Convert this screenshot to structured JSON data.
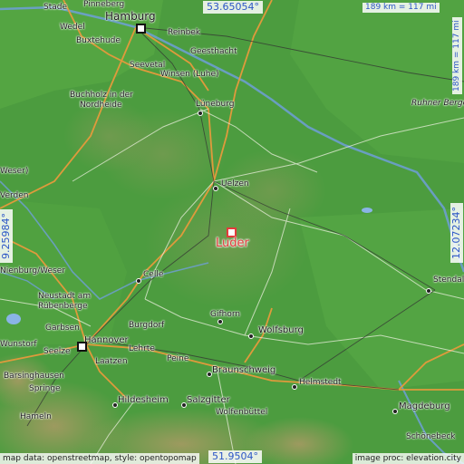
{
  "target": {
    "label": "Luder",
    "color": "#e23b3b"
  },
  "coordinates": {
    "top_lat": "53.65054°",
    "bottom_lat": "51.9504°",
    "left_lon": "9.25984°",
    "right_lon": "12.07234°"
  },
  "scale": {
    "horizontal": "189 km = 117 mi",
    "vertical": "189 km = 117 mi"
  },
  "credits": {
    "left": "map data: openstreetmap, style: opentopomap",
    "right": "image proc: elevation.city"
  },
  "places": [
    {
      "name": "Stade",
      "size": "small"
    },
    {
      "name": "Pinneberg",
      "size": "small"
    },
    {
      "name": "Hamburg",
      "size": "big"
    },
    {
      "name": "Wedel",
      "size": "small"
    },
    {
      "name": "Reinbek",
      "size": "small"
    },
    {
      "name": "Buxtehude",
      "size": "small"
    },
    {
      "name": "Geesthacht",
      "size": "small"
    },
    {
      "name": "Seevetal",
      "size": "small"
    },
    {
      "name": "Winsen (Luhe)",
      "size": "small"
    },
    {
      "name": "Buchholz in der",
      "size": "small"
    },
    {
      "name": "Nordheide",
      "size": "small"
    },
    {
      "name": "Lüneburg",
      "size": "small"
    },
    {
      "name": "Ruhner Berge",
      "size": "small"
    },
    {
      "name": "Weser)",
      "size": "small"
    },
    {
      "name": "Uelzen",
      "size": "small"
    },
    {
      "name": "Verden",
      "size": "small"
    },
    {
      "name": "Nienburg/Weser",
      "size": "small"
    },
    {
      "name": "Celle",
      "size": "small"
    },
    {
      "name": "Stendal",
      "size": "small"
    },
    {
      "name": "Neustadt am",
      "size": "small"
    },
    {
      "name": "Rübenberge",
      "size": "small"
    },
    {
      "name": "Garbsen",
      "size": "small"
    },
    {
      "name": "Burgdorf",
      "size": "small"
    },
    {
      "name": "Gifhorn",
      "size": "small"
    },
    {
      "name": "Wolfsburg",
      "size": "mid"
    },
    {
      "name": "Hannover",
      "size": "mid"
    },
    {
      "name": "Wunstorf",
      "size": "small"
    },
    {
      "name": "Seelze",
      "size": "small"
    },
    {
      "name": "Lehrte",
      "size": "small"
    },
    {
      "name": "Laatzen",
      "size": "small"
    },
    {
      "name": "Peine",
      "size": "small"
    },
    {
      "name": "Braunschweig",
      "size": "mid"
    },
    {
      "name": "Helmstedt",
      "size": "small"
    },
    {
      "name": "Barsinghausen",
      "size": "small"
    },
    {
      "name": "Springe",
      "size": "small"
    },
    {
      "name": "Hildesheim",
      "size": "mid"
    },
    {
      "name": "Salzgitter",
      "size": "mid"
    },
    {
      "name": "Magdeburg",
      "size": "mid"
    },
    {
      "name": "Wolfenbüttel",
      "size": "small"
    },
    {
      "name": "Hameln",
      "size": "small"
    },
    {
      "name": "Schönebeck",
      "size": "small"
    }
  ]
}
